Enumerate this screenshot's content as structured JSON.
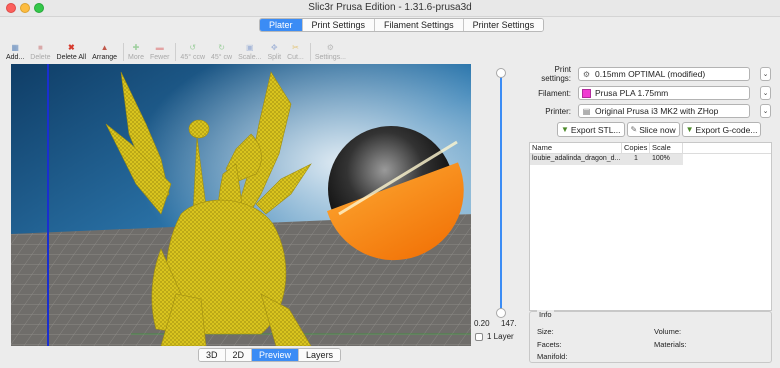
{
  "window": {
    "title": "Slic3r Prusa Edition - 1.31.6-prusa3d"
  },
  "tabs": [
    "Plater",
    "Print Settings",
    "Filament Settings",
    "Printer Settings"
  ],
  "toolbar": [
    {
      "label": "Add...",
      "icon": "add-icon",
      "enabled": true
    },
    {
      "label": "Delete",
      "icon": "delete-icon",
      "enabled": false
    },
    {
      "label": "Delete All",
      "icon": "delete-all-icon",
      "enabled": true
    },
    {
      "label": "Arrange",
      "icon": "arrange-icon",
      "enabled": true
    },
    {
      "label": "More",
      "icon": "more-icon",
      "enabled": false
    },
    {
      "label": "Fewer",
      "icon": "fewer-icon",
      "enabled": false
    },
    {
      "label": "45° ccw",
      "icon": "rotate-ccw-icon",
      "enabled": false
    },
    {
      "label": "45° cw",
      "icon": "rotate-cw-icon",
      "enabled": false
    },
    {
      "label": "Scale...",
      "icon": "scale-icon",
      "enabled": false
    },
    {
      "label": "Split",
      "icon": "split-icon",
      "enabled": false
    },
    {
      "label": "Cut...",
      "icon": "cut-icon",
      "enabled": false
    },
    {
      "label": "Settings...",
      "icon": "settings-icon",
      "enabled": false
    }
  ],
  "layer_slider": {
    "min_label": "0.20",
    "max_label": "147.",
    "checkbox_label": "1 Layer"
  },
  "view_tabs": [
    "3D",
    "2D",
    "Preview",
    "Layers"
  ],
  "settings": {
    "print_label": "Print settings:",
    "print_value": "0.15mm OPTIMAL (modified)",
    "filament_label": "Filament:",
    "filament_value": "Prusa PLA 1.75mm",
    "filament_color": "#f03cd2",
    "printer_label": "Printer:",
    "printer_value": "Original Prusa i3 MK2 with ZHop"
  },
  "actions": {
    "export_stl": "Export STL...",
    "slice_now": "Slice now",
    "export_gcode": "Export G-code..."
  },
  "object_list": {
    "headers": {
      "name": "Name",
      "copies": "Copies",
      "scale": "Scale"
    },
    "rows": [
      {
        "name": "loubie_adalinda_dragon_d...",
        "copies": "1",
        "scale": "100%"
      }
    ]
  },
  "info": {
    "title": "Info",
    "size": "Size:",
    "volume": "Volume:",
    "facets": "Facets:",
    "materials": "Materials:",
    "manifold": "Manifold:"
  }
}
